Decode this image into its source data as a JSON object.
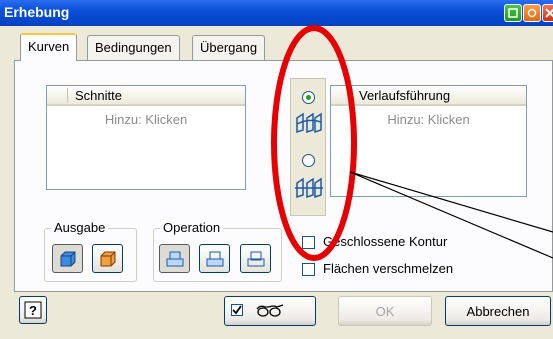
{
  "window": {
    "title": "Erhebung"
  },
  "tabs": [
    {
      "label": "Kurven",
      "active": true
    },
    {
      "label": "Bedingungen",
      "active": false
    },
    {
      "label": "Übergang",
      "active": false
    }
  ],
  "sections_list": {
    "header": "Schnitte",
    "placeholder": "Hinzu: Klicken"
  },
  "path_list": {
    "header": "Verlaufsführung",
    "placeholder": "Hinzu: Klicken"
  },
  "mode_selector": {
    "options": [
      {
        "icon": "rail-loft-icon",
        "selected": true
      },
      {
        "icon": "center-line-loft-icon",
        "selected": false
      }
    ]
  },
  "output_group": {
    "title": "Ausgabe",
    "buttons": [
      {
        "icon": "solid-icon",
        "pressed": true
      },
      {
        "icon": "surface-icon",
        "pressed": false
      }
    ]
  },
  "operation_group": {
    "title": "Operation",
    "buttons": [
      {
        "icon": "join-icon"
      },
      {
        "icon": "cut-icon"
      },
      {
        "icon": "intersect-icon"
      }
    ]
  },
  "options": {
    "closed_contour": {
      "label": "Geschlossene Kontur",
      "checked": false
    },
    "merge_faces": {
      "label": "Flächen verschmelzen",
      "checked": false
    }
  },
  "footer": {
    "preview": {
      "checked": true,
      "icon": "glasses-icon"
    },
    "ok_label": "OK",
    "cancel_label": "Abbrechen",
    "help_icon": "help-icon"
  },
  "colors": {
    "titlebar": "#0a4fd8",
    "dialog_bg": "#ece9d8",
    "annotation": "#e60000",
    "tab_highlight": "#ffc83c"
  }
}
